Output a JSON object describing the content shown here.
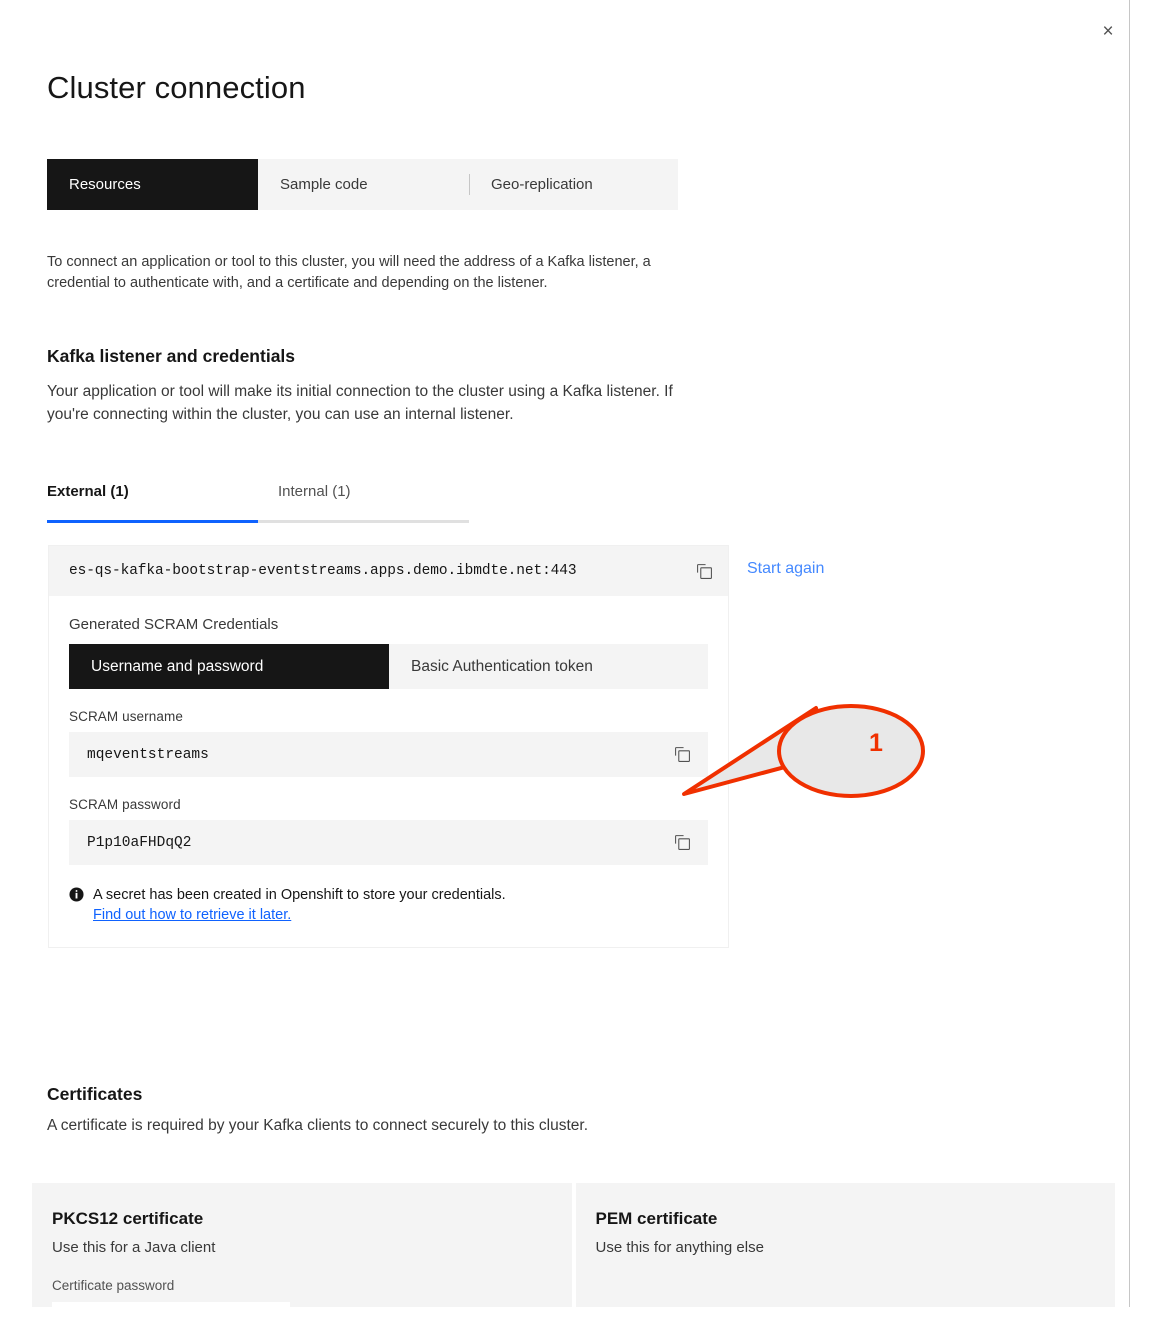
{
  "window": {
    "close_label": "×"
  },
  "header": {
    "title": "Cluster connection"
  },
  "top_tabs": {
    "items": [
      {
        "label": "Resources",
        "active": true
      },
      {
        "label": "Sample code",
        "active": false
      },
      {
        "label": "Geo-replication",
        "active": false
      }
    ]
  },
  "intro": {
    "text": "To connect an application or tool to this cluster, you will need the address of a Kafka listener, a credential to authenticate with, and a certificate and depending on the listener."
  },
  "kafka_section": {
    "heading": "Kafka listener and credentials",
    "description": "Your application or tool will make its initial connection to the cluster using a Kafka listener. If you're connecting within the cluster, you can use an internal listener."
  },
  "listener_tabs": {
    "items": [
      {
        "label": "External (1)",
        "active": true
      },
      {
        "label": "Internal (1)",
        "active": false
      }
    ]
  },
  "connection": {
    "bootstrap_address": "es-qs-kafka-bootstrap-eventstreams.apps.demo.ibmdte.net:443",
    "copy_icon": "copy-icon",
    "start_again_label": "Start again",
    "credentials_label": "Generated SCRAM Credentials",
    "auth_tabs": [
      {
        "label": "Username and password",
        "active": true
      },
      {
        "label": "Basic Authentication token",
        "active": false
      }
    ],
    "username_label": "SCRAM username",
    "username_value": "mqeventstreams",
    "password_label": "SCRAM password",
    "password_value": "P1p10aFHDqQ2",
    "note_icon": "info-icon",
    "note_text": "A secret has been created in Openshift to store your credentials.",
    "note_link": "Find out how to retrieve it later."
  },
  "certificates_section": {
    "heading": "Certificates",
    "description": "A certificate is required by your Kafka clients to connect securely to this cluster.",
    "cards": [
      {
        "title": "PKCS12 certificate",
        "subtitle": "Use this for a Java client",
        "field_label": "Certificate password"
      },
      {
        "title": "PEM certificate",
        "subtitle": "Use this for anything else",
        "field_label": ""
      }
    ]
  },
  "annotation": {
    "number": "1",
    "color": "#f03000"
  }
}
